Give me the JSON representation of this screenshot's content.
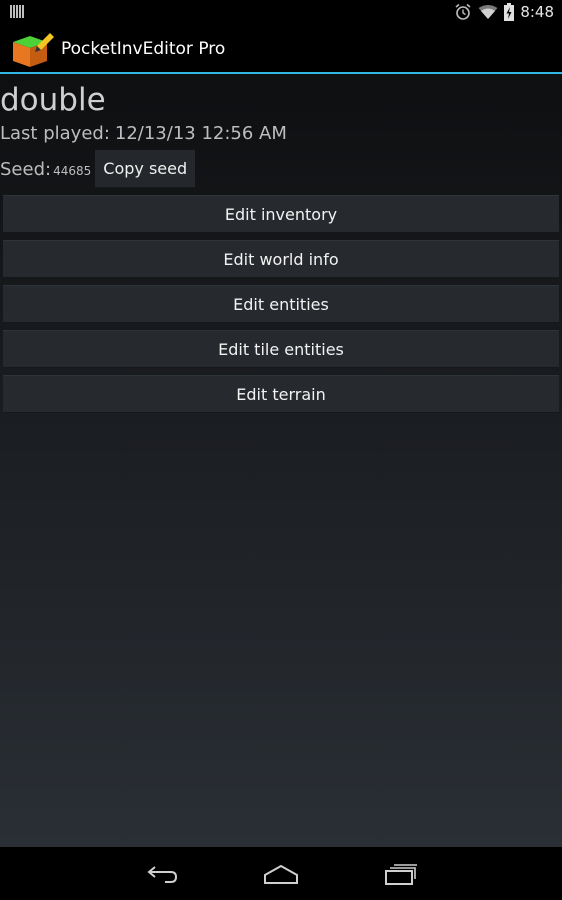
{
  "status_bar": {
    "time": "8:48",
    "icons": [
      "notification-icon",
      "alarm-icon",
      "wifi-icon",
      "battery-icon"
    ]
  },
  "action_bar": {
    "title": "PocketInvEditor Pro",
    "accent_color": "#33b5e5"
  },
  "world": {
    "name": "double",
    "last_played_label": "Last played:",
    "last_played_value": "12/13/13 12:56 AM",
    "seed_label": "Seed:",
    "seed_value": "44685",
    "copy_seed_label": "Copy seed"
  },
  "buttons": [
    {
      "label": "Edit inventory"
    },
    {
      "label": "Edit world info"
    },
    {
      "label": "Edit entities"
    },
    {
      "label": "Edit tile entities"
    },
    {
      "label": "Edit terrain"
    }
  ],
  "nav_bar": {
    "icons": [
      "back-icon",
      "home-icon",
      "recent-apps-icon"
    ]
  }
}
